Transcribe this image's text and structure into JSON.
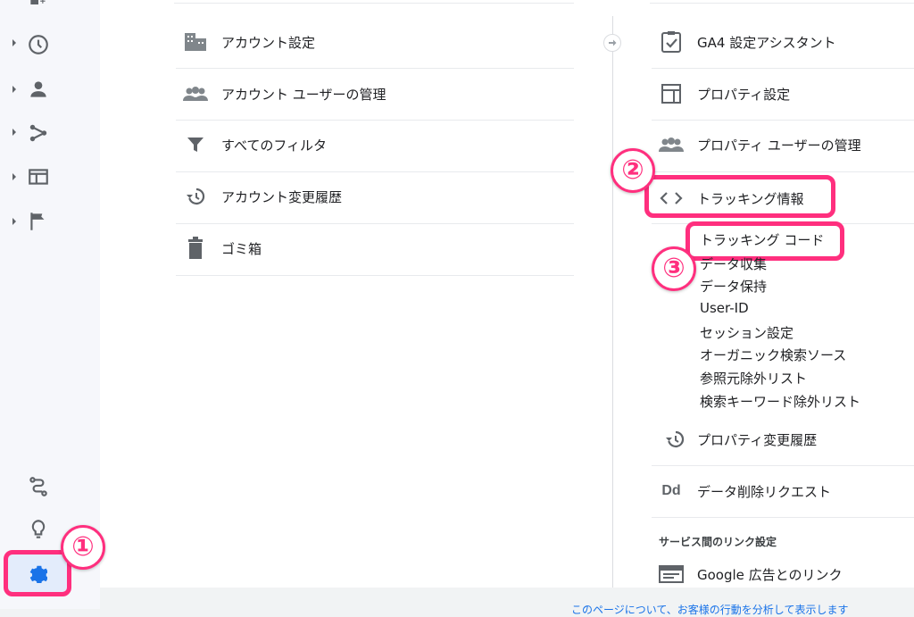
{
  "account_column": {
    "items": [
      {
        "label": "アカウント設定",
        "icon": "building-icon"
      },
      {
        "label": "アカウント ユーザーの管理",
        "icon": "users-icon"
      },
      {
        "label": "すべてのフィルタ",
        "icon": "filter-icon"
      },
      {
        "label": "アカウント変更履歴",
        "icon": "history-icon"
      },
      {
        "label": "ゴミ箱",
        "icon": "trash-icon"
      }
    ]
  },
  "property_column": {
    "items": [
      {
        "label": "GA4 設定アシスタント",
        "icon": "checklist-icon"
      },
      {
        "label": "プロパティ設定",
        "icon": "layout-icon"
      },
      {
        "label": "プロパティ ユーザーの管理",
        "icon": "users-icon"
      },
      {
        "label": "トラッキング情報",
        "icon": "code-icon"
      }
    ],
    "tracking_subitems": [
      "トラッキング コード",
      "データ収集",
      "データ保持",
      "User-ID",
      "セッション設定",
      "オーガニック検索ソース",
      "参照元除外リスト",
      "検索キーワード除外リスト"
    ],
    "items_after": [
      {
        "label": "プロパティ変更履歴",
        "icon": "history-icon"
      },
      {
        "label": "データ削除リクエスト",
        "icon": "dd-icon",
        "icon_text": "Dd"
      }
    ],
    "section_title": "サービス間のリンク設定",
    "link_items": [
      {
        "label": "Google 広告とのリンク",
        "icon": "ads-icon"
      }
    ]
  },
  "annotations": {
    "step1": "①",
    "step2": "②",
    "step3": "③",
    "highlight_color": "#ff2f7e"
  },
  "footer": {
    "partial_text": "このページについて、お客様の行動を分析して表示します"
  },
  "colors": {
    "accent": "#1a73e8",
    "icon_gray": "#5f6368"
  }
}
